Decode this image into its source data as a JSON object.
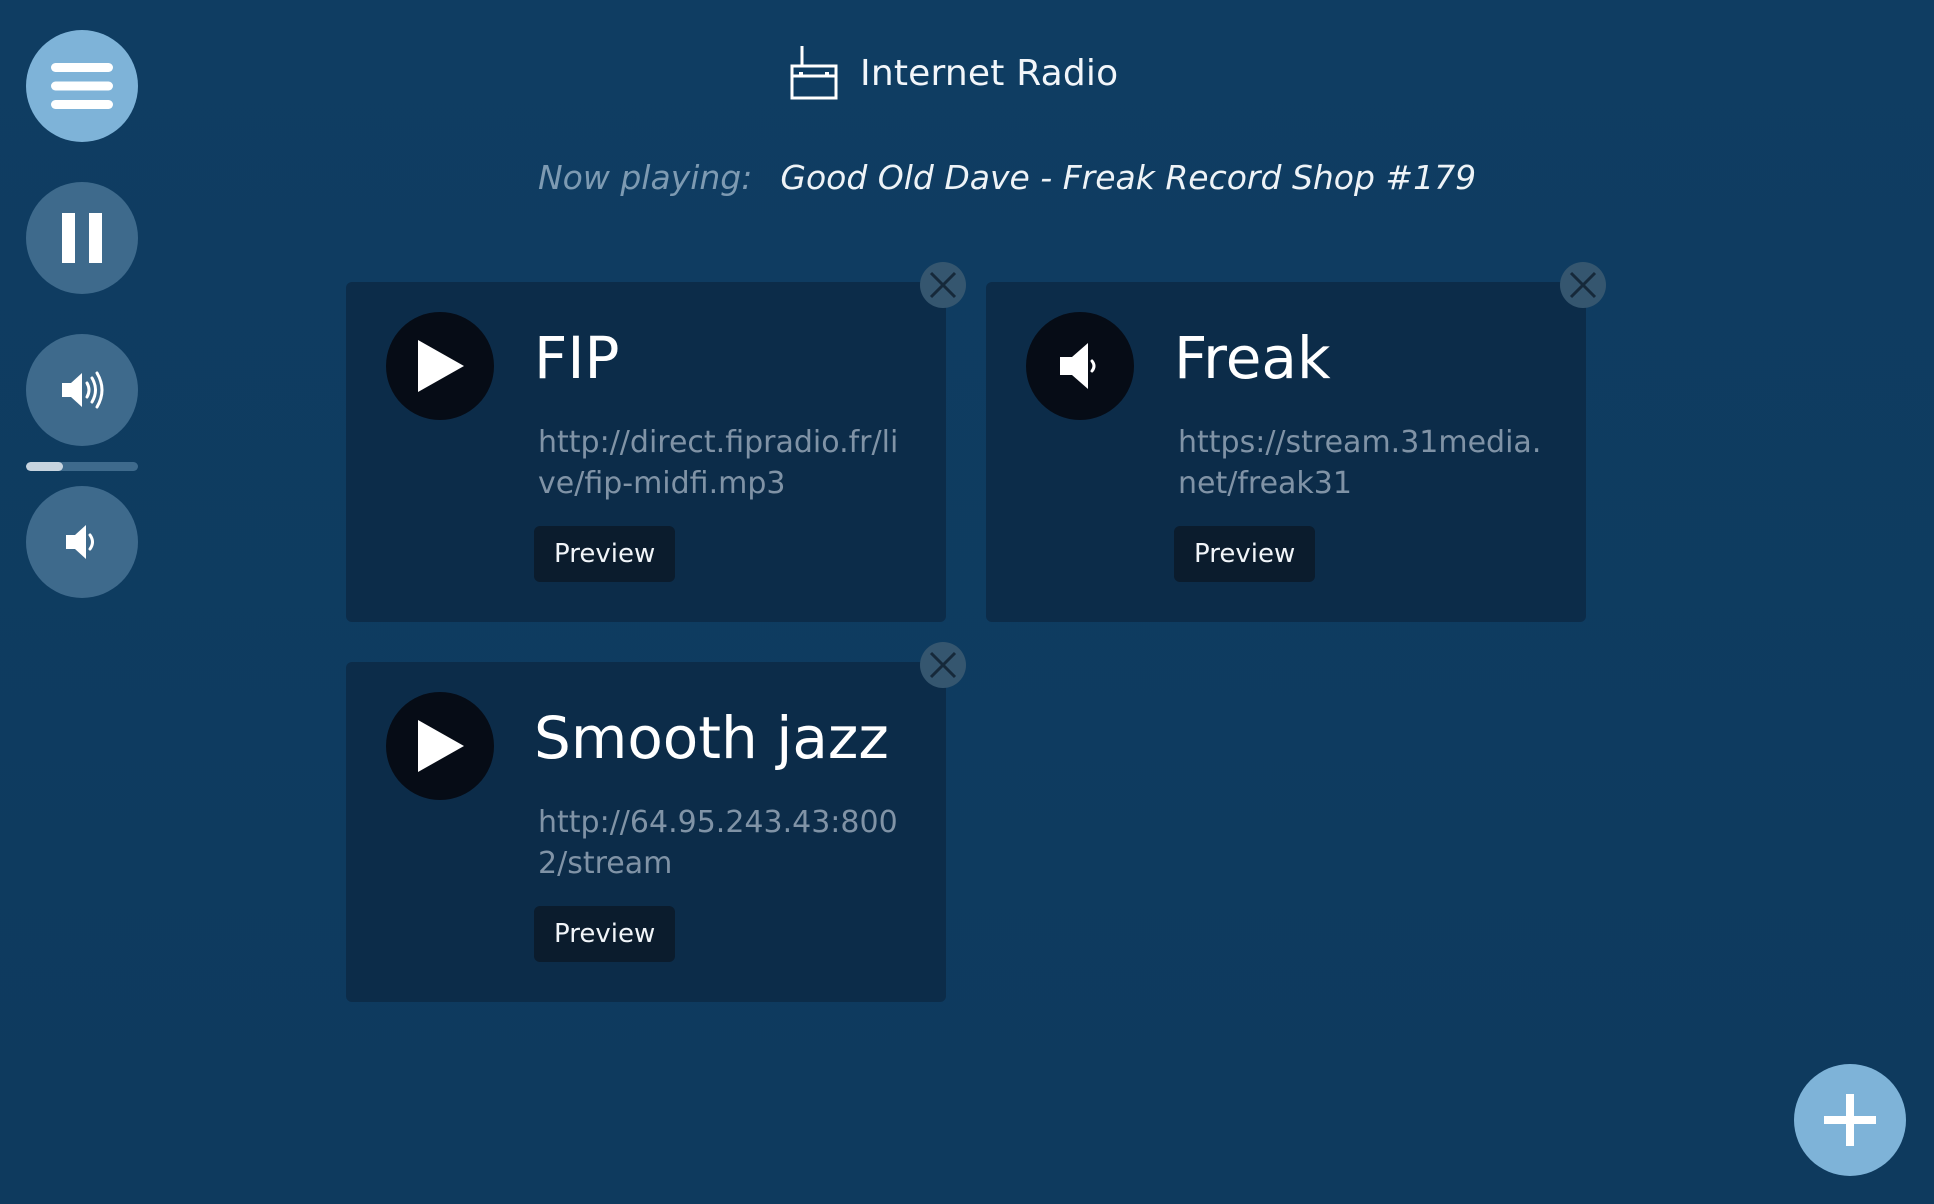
{
  "app": {
    "title": "Internet Radio",
    "radio_icon": "radio-icon"
  },
  "now_playing": {
    "label": "Now playing:",
    "value": "Good Old Dave - Freak Record Shop #179"
  },
  "controls": {
    "menu_icon": "hamburger-menu-icon",
    "pause_icon": "pause-icon",
    "volume_up_icon": "volume-up-icon",
    "volume_down_icon": "volume-down-icon",
    "volume_level_fraction": 0.33
  },
  "stations": [
    {
      "name": "FIP",
      "url": "http://direct.fipradio.fr/live/fip-midfi.mp3",
      "state_icon": "play-icon",
      "preview_label": "Preview"
    },
    {
      "name": "Freak",
      "url": "https://stream.31media.net/freak31",
      "state_icon": "speaker-icon",
      "preview_label": "Preview"
    },
    {
      "name": "Smooth jazz",
      "url": "http://64.95.243.43:8002/stream",
      "state_icon": "play-icon",
      "preview_label": "Preview"
    }
  ],
  "add_button_icon": "plus-icon",
  "colors": {
    "background": "#0f3c60",
    "card": "#0c2c49",
    "accent": "#7eb3d8",
    "control": "#3e6a8c"
  }
}
